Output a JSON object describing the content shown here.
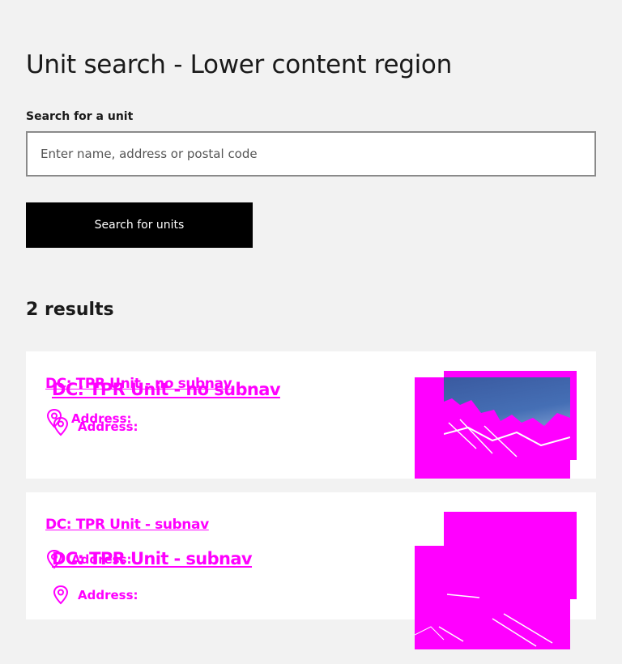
{
  "page": {
    "title": "Unit search - Lower content region"
  },
  "search": {
    "label": "Search for a unit",
    "placeholder": "Enter name, address or postal code",
    "value": "",
    "button_label": "Search for units"
  },
  "results": {
    "count_label": "2 results",
    "items": [
      {
        "title": "DC: TPR Unit - no subnav",
        "address_label": "Address:",
        "icon": "location-pin-icon"
      },
      {
        "title": "DC: TPR Unit - subnav",
        "address_label": "Address:",
        "icon": "location-pin-icon"
      }
    ]
  },
  "colors": {
    "background": "#f2f2f2",
    "card": "#ffffff",
    "button": "#000000",
    "button_text": "#ffffff",
    "missing_asset": "#ff00ff"
  }
}
